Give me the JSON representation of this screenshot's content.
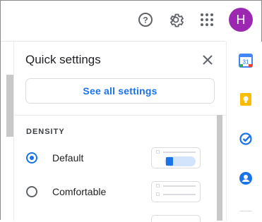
{
  "header": {
    "avatar_letter": "H",
    "help_icon": "help-icon",
    "settings_icon": "gear-icon",
    "apps_icon": "apps-grid-icon"
  },
  "panel": {
    "title": "Quick settings",
    "see_all_label": "See all settings",
    "density_heading": "DENSITY",
    "options": [
      {
        "label": "Default",
        "selected": true
      },
      {
        "label": "Comfortable",
        "selected": false
      }
    ]
  },
  "side_rail": {
    "icons": [
      "calendar-icon",
      "keep-icon",
      "tasks-icon",
      "contacts-icon"
    ],
    "calendar_day": "31"
  },
  "colors": {
    "accent": "#1a73e8",
    "avatar": "#9c27b0",
    "keep": "#fbbc04"
  }
}
